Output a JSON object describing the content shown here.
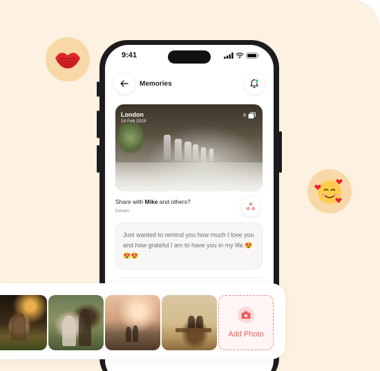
{
  "status_bar": {
    "time": "9:41"
  },
  "header": {
    "title": "Memories"
  },
  "memory": {
    "city": "London",
    "date": "14 Feb 2019",
    "photo_count": "6"
  },
  "share": {
    "prefix": "Share with ",
    "name": "Mike",
    "suffix": " and others?",
    "details": "Details"
  },
  "message": {
    "text": "Just wanted to remind you how much I love you and how grateful I am to have you in my life.😍😍😍"
  },
  "strip": {
    "add_photo_label": "Add Photo"
  },
  "colors": {
    "background": "#fdf1e1",
    "emoji_bubble": "#f8d8a7",
    "accent": "#e85d5d",
    "notification_dot": "#34c759"
  },
  "icons": [
    "kiss-lips-icon",
    "smiling-face-with-hearts-icon",
    "back-arrow-icon",
    "bell-icon",
    "photo-stack-icon",
    "share-icon",
    "camera-icon",
    "signal-icon",
    "wifi-icon",
    "battery-icon"
  ]
}
